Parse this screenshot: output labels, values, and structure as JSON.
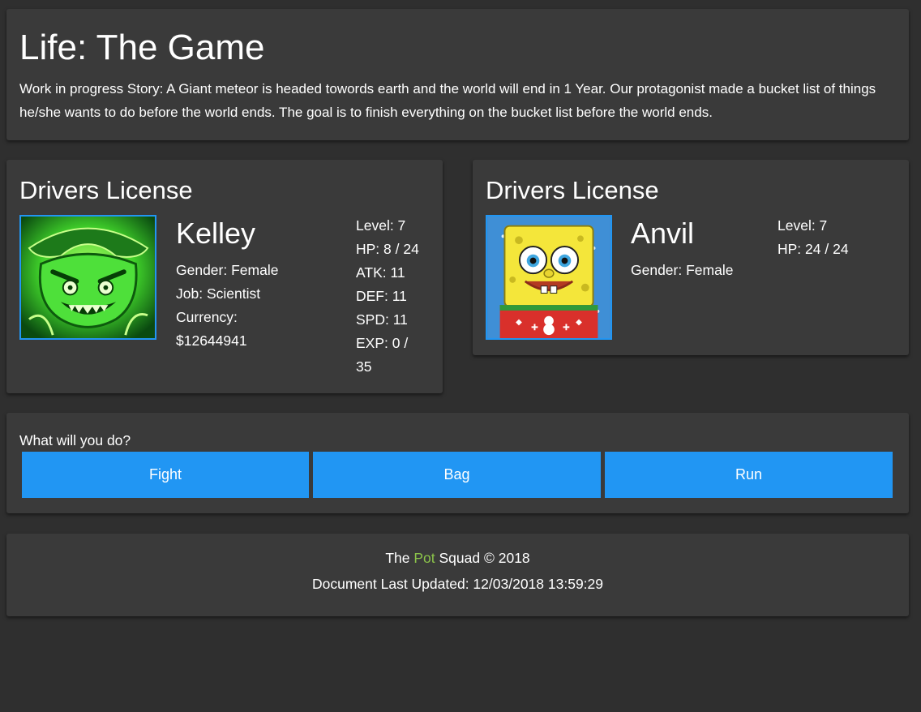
{
  "header": {
    "title": "Life: The Game",
    "story": "Work in progress Story: A Giant meteor is headed towords earth and the world will end in 1 Year. Our protagonist made a bucket list of things he/she wants to do before the world ends. The goal is to finish everything on the bucket list before the world ends."
  },
  "player": {
    "card_title": "Drivers License",
    "name": "Kelley",
    "gender": "Gender: Female",
    "job": "Job: Scientist",
    "currency_label": "Currency:",
    "currency_value": "$12644941",
    "stats": {
      "level": "Level: 7",
      "hp": "HP: 8 / 24",
      "atk": "ATK: 11",
      "def": "DEF: 11",
      "spd": "SPD: 11",
      "exp_a": "EXP: 0 /",
      "exp_b": "35"
    },
    "hp_current": 8,
    "hp_max": 24,
    "portrait": "green-ghost-pirate-portrait"
  },
  "enemy": {
    "card_title": "Drivers License",
    "name": "Anvil",
    "gender": "Gender: Female",
    "stats": {
      "level": "Level: 7",
      "hp": "HP: 24 / 24"
    },
    "hp_current": 24,
    "hp_max": 24,
    "portrait": "spongebob-christmas-sweater-portrait"
  },
  "actions": {
    "prompt": "What will you do?",
    "buttons": [
      "Fight",
      "Bag",
      "Run"
    ]
  },
  "footer": {
    "pre": "The ",
    "accent": "Pot",
    "post": " Squad © 2018",
    "updated": "Document Last Updated: 12/03/2018 13:59:29"
  },
  "colors": {
    "page_bg": "#2f2f2f",
    "card_bg": "#3a3a3a",
    "button": "#2196f3",
    "accent_text": "#8bc34a",
    "portrait_border": "#2196f3"
  }
}
